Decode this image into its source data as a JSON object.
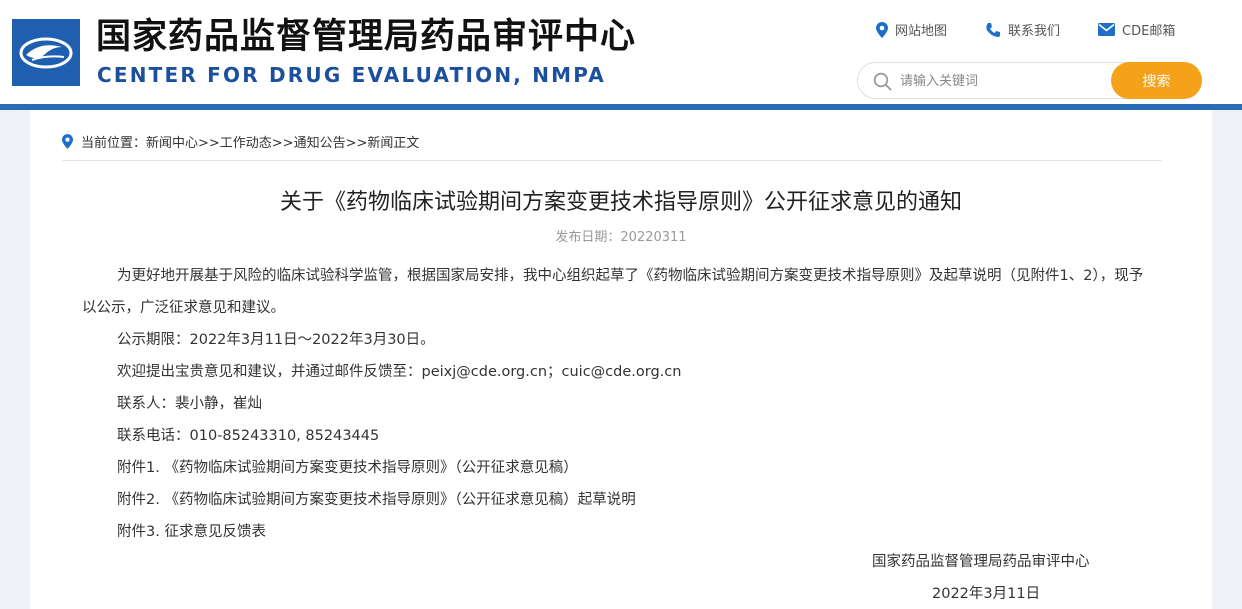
{
  "header": {
    "title_cn": "国家药品监督管理局药品审评中心",
    "title_en": "CENTER FOR DRUG EVALUATION, NMPA",
    "links": [
      {
        "icon": "location-pin-icon",
        "label": "网站地图"
      },
      {
        "icon": "phone-icon",
        "label": "联系我们"
      },
      {
        "icon": "mail-icon",
        "label": "CDE邮箱"
      }
    ],
    "search": {
      "placeholder": "请输入关键词",
      "button": "搜索"
    }
  },
  "breadcrumb": {
    "text": "当前位置：新闻中心>>工作动态>>通知公告>>新闻正文"
  },
  "article": {
    "title": "关于《药物临床试验期间方案变更技术指导原则》公开征求意见的通知",
    "date": "发布日期：20220311",
    "paragraphs": [
      "为更好地开展基于风险的临床试验科学监管，根据国家局安排，我中心组织起草了《药物临床试验期间方案变更技术指导原则》及起草说明（见附件1、2），现予以公示，广泛征求意见和建议。",
      "公示期限：2022年3月11日～2022年3月30日。",
      "欢迎提出宝贵意见和建议，并通过邮件反馈至：peixj@cde.org.cn；cuic@cde.org.cn",
      "联系人：裴小静，崔灿",
      "联系电话：010-85243310, 85243445",
      "附件1. 《药物临床试验期间方案变更技术指导原则》（公开征求意见稿）",
      "附件2. 《药物临床试验期间方案变更技术指导原则》（公开征求意见稿）起草说明",
      "附件3. 征求意见反馈表"
    ],
    "signature_org": "国家药品监督管理局药品审评中心",
    "signature_date": "2022年3月11日"
  },
  "colors": {
    "brand_blue": "#1f5fb0",
    "accent_orange": "#f5a21b",
    "link_icon_blue": "#1f6fc9"
  }
}
